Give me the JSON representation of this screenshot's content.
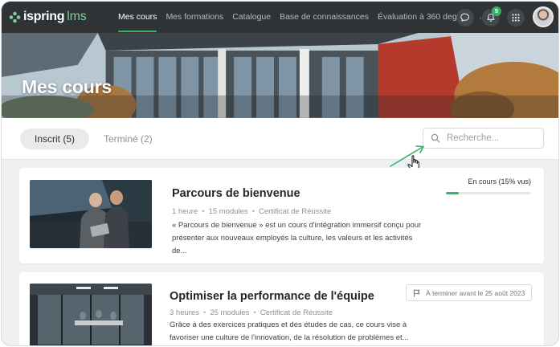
{
  "brand": {
    "name_part1": "ispring",
    "name_part2": "lms",
    "accent": "#3bb06a"
  },
  "nav": {
    "items": [
      {
        "label": "Mes cours",
        "active": true
      },
      {
        "label": "Mes formations",
        "active": false
      },
      {
        "label": "Catalogue",
        "active": false
      },
      {
        "label": "Base de connaissances",
        "active": false
      },
      {
        "label": "Évaluation à 360 degrés",
        "active": false
      }
    ],
    "more": "···",
    "notification_count": "5",
    "icons": [
      "chat-icon",
      "bell-icon",
      "apps-grid-icon"
    ]
  },
  "hero": {
    "title": "Mes cours"
  },
  "tabs": [
    {
      "label": "Inscrit (5)",
      "active": true
    },
    {
      "label": "Terminé (2)",
      "active": false
    }
  ],
  "search": {
    "placeholder": "Recherche...",
    "value": ""
  },
  "courses": [
    {
      "title": "Parcours de bienvenue",
      "duration": "1 heure",
      "modules": "15 modules",
      "certificate": "Certificat de Réussite",
      "description": "« Parcours de bienvenue » est un cours d'intégration immersif conçu pour présenter aux nouveaux employés la culture, les valeurs et les activités de...",
      "status": "En cours (15% vus)",
      "progress": 15
    },
    {
      "title": "Optimiser la performance de l'équipe",
      "duration": "3 heures",
      "modules": "25 modules",
      "certificate": "Certificat de Réussite",
      "description": "Grâce à des exercices pratiques et des études de cas, ce cours vise à favoriser une culture de l'innovation, de la résolution de problèmes et...",
      "deadline": "À terminer avant le 25 août 2023"
    }
  ]
}
